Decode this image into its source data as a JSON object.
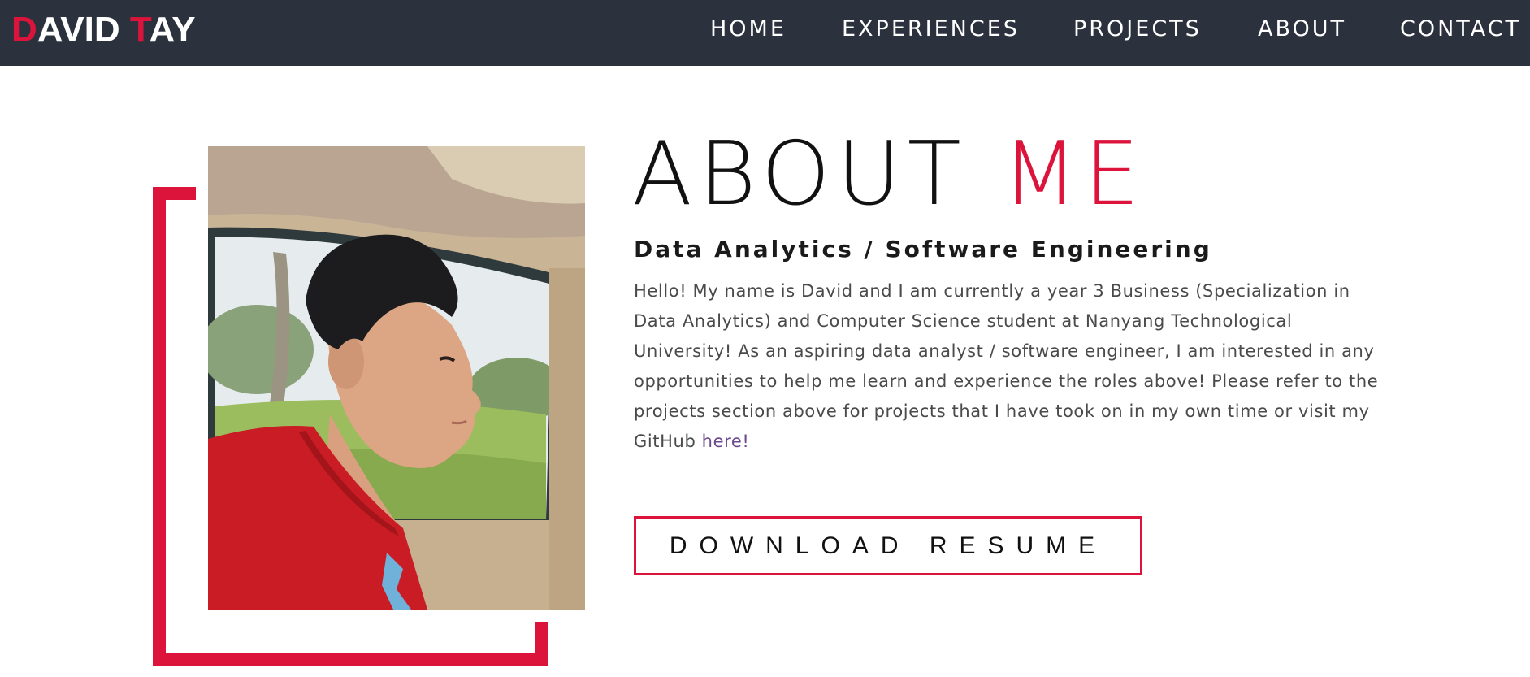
{
  "navbar": {
    "logo": {
      "first_initial": "D",
      "first_rest": "AVID ",
      "last_initial": "T",
      "last_rest": "AY"
    },
    "links": [
      "HOME",
      "EXPERIENCES",
      "PROJECTS",
      "ABOUT",
      "CONTACT"
    ]
  },
  "about": {
    "title_main": "ABOUT ",
    "title_accent": "ME",
    "subtitle": "Data Analytics / Software Engineering",
    "bio_text": "Hello! My name is David and I am currently a year 3 Business (Specialization in Data Analytics) and Computer Science student at Nanyang Technological University! As an aspiring data analyst / software engineer, I am interested in any opportunities to help me learn and experience the roles above! Please refer to the projects section above for projects that I have took on in my own time or visit my GitHub ",
    "bio_link": "here!",
    "resume_button": "DOWNLOAD RESUME"
  },
  "colors": {
    "accent": "#dc143c",
    "navbar_bg": "#2b323d",
    "link": "#6b4a8a"
  }
}
